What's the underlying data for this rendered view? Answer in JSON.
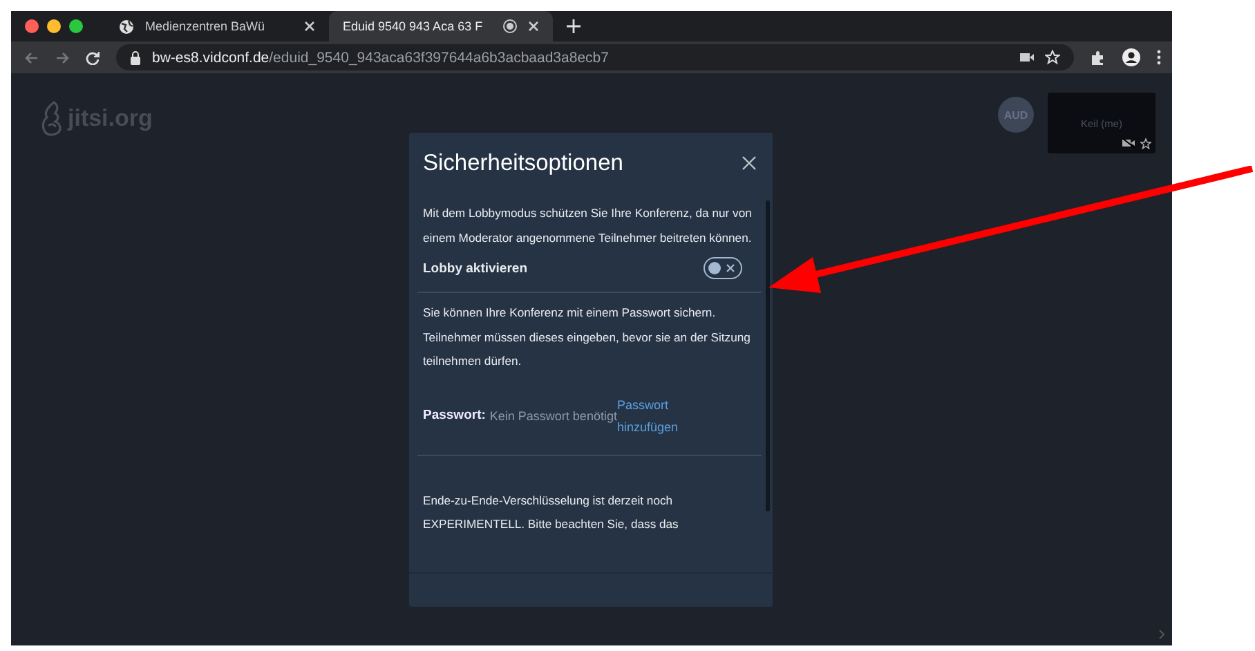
{
  "browser": {
    "tabs": [
      {
        "title": "Medienzentren BaWü",
        "selected": false
      },
      {
        "title": "Eduid 9540 943 Aca 63 F",
        "selected": true
      }
    ],
    "url_host": "bw-es8.vidconf.de",
    "url_path": "/eduid_9540_943aca63f397644a6b3acbaad3a8ecb7"
  },
  "conference": {
    "logo": "jitsi.org",
    "avatar": "AUD",
    "tile_name": "Keil (me)"
  },
  "dialog": {
    "title": "Sicherheitsoptionen",
    "lobby": {
      "text": "Mit dem Lobbymodus schützen Sie Ihre Konferenz, da nur von einem Moderator angenommene Teilnehmer beitreten können.",
      "toggle_label": "Lobby aktivieren",
      "on": false
    },
    "password": {
      "text": "Sie können Ihre Konferenz mit einem Passwort sichern. Teilnehmer müssen dieses eingeben, bevor sie an der Sitzung teilnehmen dürfen.",
      "label": "Passwort:",
      "value": "Kein Passwort benötigt",
      "link": "Passwort hinzufügen"
    },
    "e2ee": {
      "text": "Ende-zu-Ende-Verschlüsselung ist derzeit noch EXPERIMENTELL. Bitte beachten Sie, dass das"
    }
  }
}
